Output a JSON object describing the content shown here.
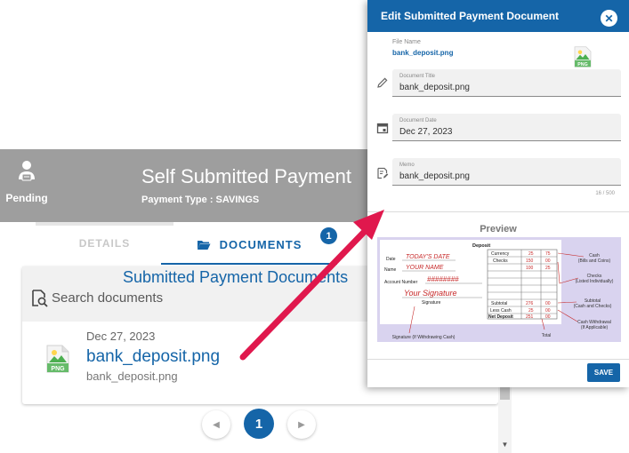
{
  "page": {
    "status_label": "Pending",
    "title": "Self Submitted Payment",
    "subtitle": "Payment Type : SAVINGS"
  },
  "tabs": {
    "details_label": "DETAILS",
    "documents_label": "DOCUMENTS",
    "documents_badge": "1"
  },
  "documents": {
    "heading": "Submitted Payment  Documents",
    "search_placeholder": "Search documents",
    "items": [
      {
        "date": "Dec 27, 2023",
        "name": "bank_deposit.png",
        "file": "bank_deposit.png",
        "icon": "png-file-icon"
      }
    ]
  },
  "pagination": {
    "current": "1"
  },
  "dialog": {
    "title": "Edit Submitted Payment Document",
    "file_name_label": "File Name",
    "file_name": "bank_deposit.png",
    "fields": {
      "title": {
        "label": "Document Title",
        "value": "bank_deposit.png",
        "icon": "pencil-icon"
      },
      "date": {
        "label": "Document Date",
        "value": "Dec 27, 2023",
        "icon": "calendar-icon"
      },
      "memo": {
        "label": "Memo",
        "value": "bank_deposit.png",
        "icon": "memo-icon"
      }
    },
    "memo_counter": "16 / 500",
    "preview_title": "Preview",
    "save_label": "SAVE"
  },
  "preview_slip": {
    "heading": "Deposit",
    "date_label": "Date",
    "date_value": "TODAY'S DATE",
    "name_label": "Name",
    "name_value": "YOUR NAME",
    "account_label": "Account Number",
    "account_value": "########",
    "signature_value": "Your Signature",
    "signature_label": "Signature",
    "rows": [
      {
        "label": "Currency",
        "dollars": "25",
        "cents": "75"
      },
      {
        "label": "Checks",
        "dollars": "150",
        "cents": "00"
      },
      {
        "label": "",
        "dollars": "100",
        "cents": "25"
      },
      {
        "label": "Subtotal",
        "dollars": "276",
        "cents": "00"
      },
      {
        "label": "Less Cash",
        "dollars": "25",
        "cents": "00"
      },
      {
        "label": "Net Deposit",
        "dollars": "251",
        "cents": "00"
      }
    ],
    "notes": {
      "cash": "Cash\n(Bills and Coins)",
      "checks": "Checks\n(Listed Individually)",
      "subtotal": "Subtotal\n(Cash and Checks)",
      "withdrawal": "Cash Withdrawal\n(If Applicable)",
      "total": "Total",
      "signature": "Signature (If Withdrawing Cash)"
    }
  },
  "colors": {
    "primary": "#1565a8",
    "header_gray": "#9e9e9e",
    "annotation_red": "#e0184d",
    "preview_bg": "#d9d3ef"
  }
}
